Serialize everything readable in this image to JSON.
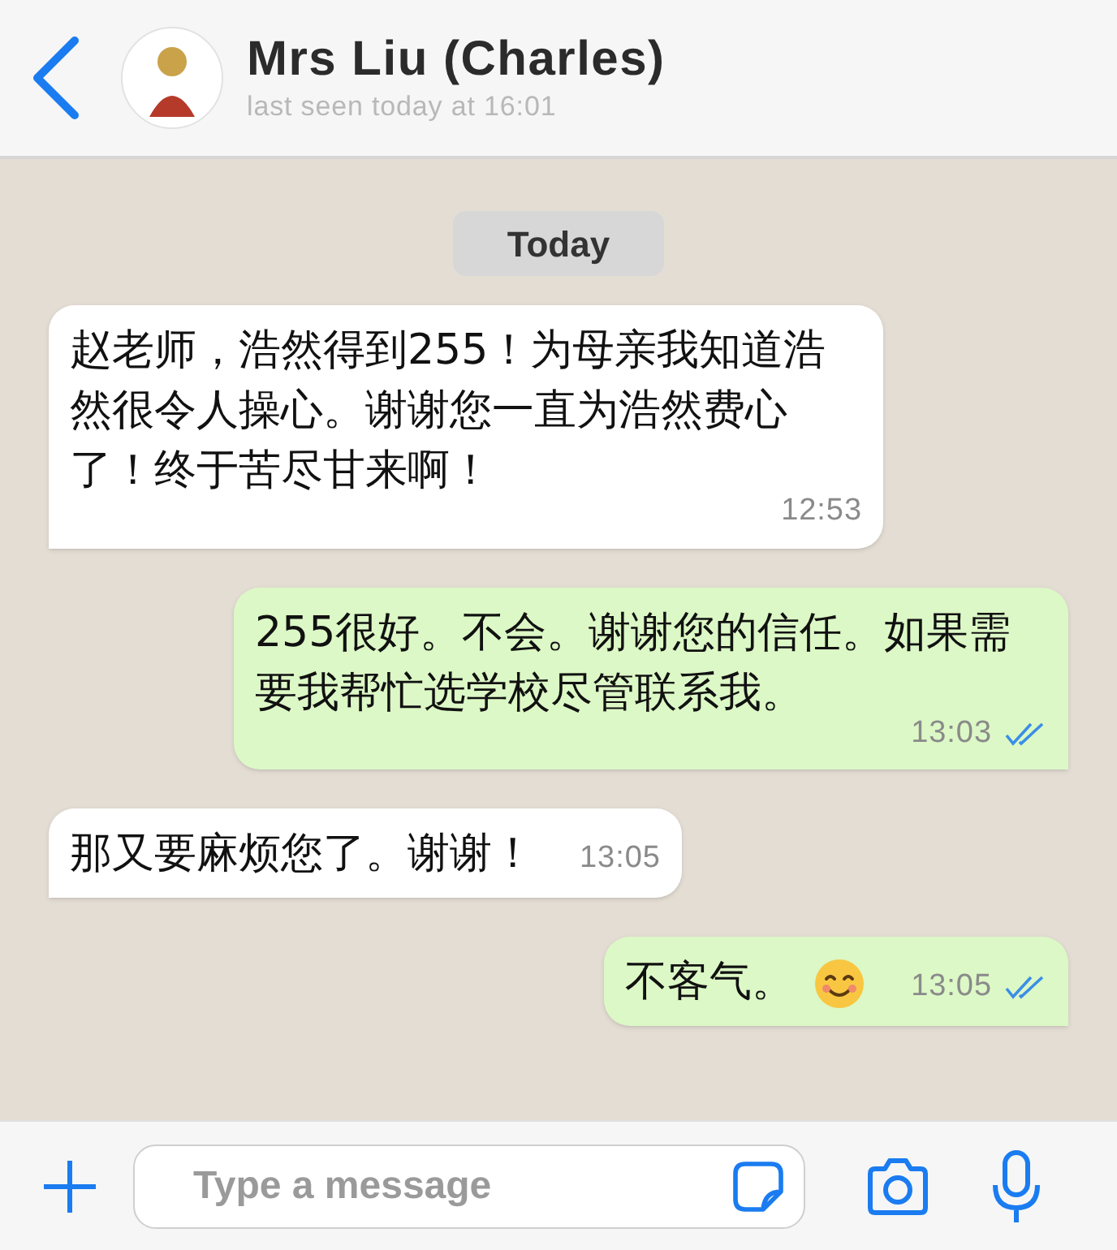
{
  "header": {
    "contact_name": "Mrs Liu (Charles)",
    "last_seen": "last seen today at 16:01"
  },
  "date_divider": "Today",
  "messages": [
    {
      "kind": "incoming",
      "text": "赵老师，浩然得到255！为母亲我知道浩然很令人操心。谢谢您一直为浩然费心了！终于苦尽甘来啊！",
      "time": "12:53"
    },
    {
      "kind": "outgoing",
      "text": "255很好。不会。谢谢您的信任。如果需要我帮忙选学校尽管联系我。",
      "time": "13:03",
      "read": true
    },
    {
      "kind": "incoming",
      "text": "那又要麻烦您了。谢谢！",
      "time": "13:05"
    },
    {
      "kind": "outgoing",
      "text": "不客气。",
      "emoji": true,
      "time": "13:05",
      "read": true
    }
  ],
  "composer": {
    "placeholder": "Type a message"
  }
}
